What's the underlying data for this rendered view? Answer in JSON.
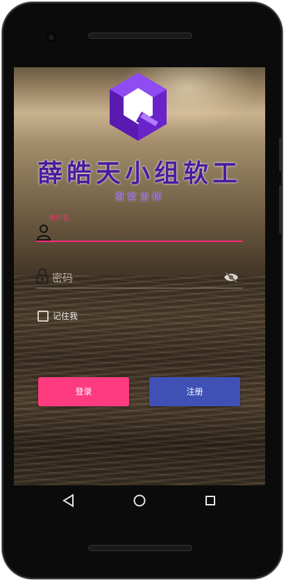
{
  "app": {
    "title": "薛皓天小组软工",
    "subtitle": "恩紫吉样"
  },
  "login_form": {
    "username_label": "用户名",
    "password_placeholder": "密码",
    "remember_label": "记住我",
    "remember_checked": false,
    "login_button": "登录",
    "register_button": "注册"
  },
  "icons": {
    "logo": "q-logo",
    "username": "person-icon",
    "password": "lock-icon",
    "password_toggle": "eye-off-icon",
    "nav_back": "back-triangle-icon",
    "nav_home": "home-circle-icon",
    "nav_recents": "recents-square-icon"
  },
  "colors": {
    "accent_pink": "#ff3b80",
    "accent_indigo": "#3f51b5",
    "title_purple": "#4a1c9e",
    "logo_purple": "#7b2ff0"
  }
}
